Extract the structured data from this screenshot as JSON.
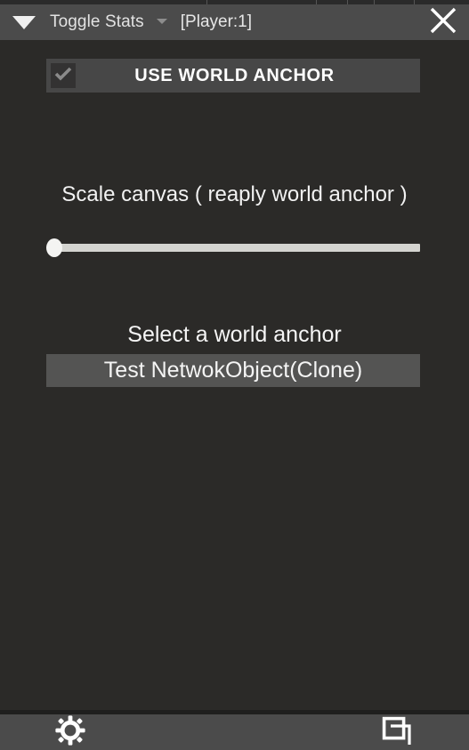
{
  "window": {
    "titlebar": {
      "collapse_icon": "triangle-down-icon",
      "title": "Toggle Stats",
      "dropdown_caret_icon": "chevron-down-small-icon",
      "player_tag": "[Player:1]",
      "close_icon": "close-x-icon"
    },
    "colors": {
      "titlebar_bg": "#4b4b4b",
      "body_bg": "#2b2a28",
      "row_bg": "#474747",
      "select_bg": "#545453",
      "slider_track": "#d4d4d0",
      "slider_handle": "#f4f4f2",
      "text": "#f2f2f2"
    }
  },
  "main": {
    "toggle": {
      "label": "USE WORLD ANCHOR",
      "checked": true,
      "check_icon": "checkmark-icon"
    },
    "scale": {
      "label": "Scale canvas ( reaply world anchor )",
      "slider_value": 0,
      "slider_min": 0,
      "slider_max": 100
    },
    "anchor_select": {
      "label": "Select a world anchor",
      "selected_value": "Test NetwokObject(Clone)"
    }
  },
  "bottombar": {
    "settings_icon": "gear-icon",
    "windows_icon": "copy-windows-icon"
  },
  "underlay": {
    "tick_positions": [
      232,
      355,
      390,
      420,
      465
    ]
  }
}
